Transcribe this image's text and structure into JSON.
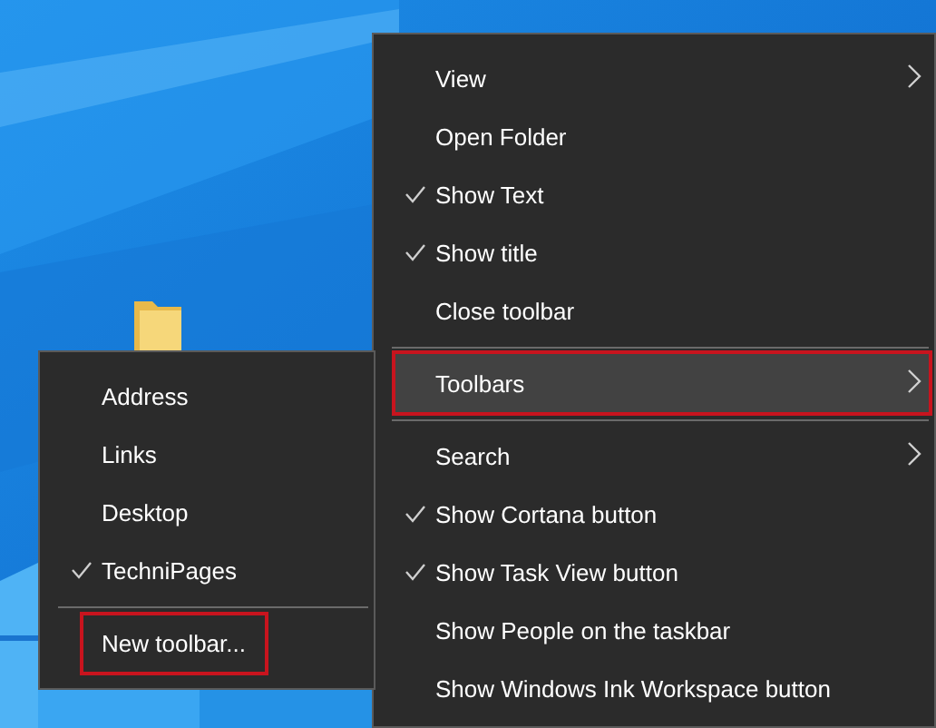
{
  "context_menu": {
    "items": [
      {
        "kind": "item",
        "label": "View",
        "checked": false,
        "submenu": true,
        "selected": false,
        "outlined": false
      },
      {
        "kind": "item",
        "label": "Open Folder",
        "checked": false,
        "submenu": false,
        "selected": false,
        "outlined": false
      },
      {
        "kind": "item",
        "label": "Show Text",
        "checked": true,
        "submenu": false,
        "selected": false,
        "outlined": false
      },
      {
        "kind": "item",
        "label": "Show title",
        "checked": true,
        "submenu": false,
        "selected": false,
        "outlined": false
      },
      {
        "kind": "item",
        "label": "Close toolbar",
        "checked": false,
        "submenu": false,
        "selected": false,
        "outlined": false
      },
      {
        "kind": "separator"
      },
      {
        "kind": "item",
        "label": "Toolbars",
        "checked": false,
        "submenu": true,
        "selected": true,
        "outlined": true
      },
      {
        "kind": "separator"
      },
      {
        "kind": "item",
        "label": "Search",
        "checked": false,
        "submenu": true,
        "selected": false,
        "outlined": false
      },
      {
        "kind": "item",
        "label": "Show Cortana button",
        "checked": true,
        "submenu": false,
        "selected": false,
        "outlined": false
      },
      {
        "kind": "item",
        "label": "Show Task View button",
        "checked": true,
        "submenu": false,
        "selected": false,
        "outlined": false
      },
      {
        "kind": "item",
        "label": "Show People on the taskbar",
        "checked": false,
        "submenu": false,
        "selected": false,
        "outlined": false
      },
      {
        "kind": "item",
        "label": "Show Windows Ink Workspace button",
        "checked": false,
        "submenu": false,
        "selected": false,
        "outlined": false
      }
    ]
  },
  "toolbars_submenu": {
    "items": [
      {
        "kind": "item",
        "label": "Address",
        "checked": false,
        "submenu": false,
        "selected": false,
        "outlined": false
      },
      {
        "kind": "item",
        "label": "Links",
        "checked": false,
        "submenu": false,
        "selected": false,
        "outlined": false
      },
      {
        "kind": "item",
        "label": "Desktop",
        "checked": false,
        "submenu": false,
        "selected": false,
        "outlined": false
      },
      {
        "kind": "item",
        "label": "TechniPages",
        "checked": true,
        "submenu": false,
        "selected": false,
        "outlined": false
      },
      {
        "kind": "separator"
      },
      {
        "kind": "item",
        "label": "New toolbar...",
        "checked": false,
        "submenu": false,
        "selected": false,
        "outlined": true
      }
    ]
  }
}
